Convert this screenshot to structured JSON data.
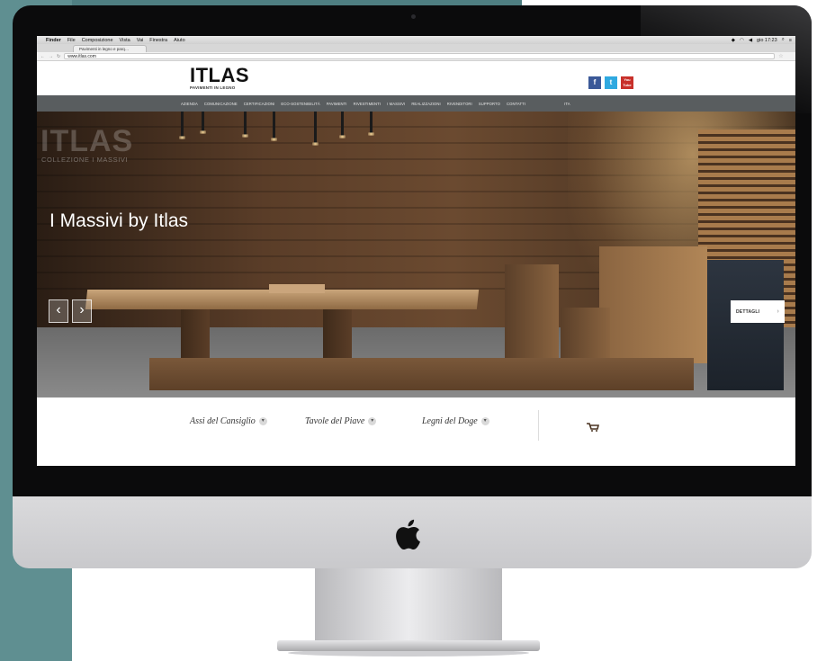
{
  "mac_menubar": {
    "apple_symbol": "",
    "items": [
      "Finder",
      "File",
      "Composizione",
      "Vista",
      "Vai",
      "Finestra",
      "Aiuto"
    ],
    "clock": "gio 17:23"
  },
  "browser": {
    "tab_title": "Pavimenti in legno e parq…",
    "url": "www.itlas.com"
  },
  "site": {
    "logo": "ITLAS",
    "tagline": "PAVIMENTI IN LEGNO",
    "social": [
      "f",
      "t",
      "You Tube"
    ],
    "nav": [
      "AZIENDA",
      "COMUNICAZIONE",
      "CERTIFICAZIONI",
      "ECO-SOSTENIBILITÀ",
      "PAVIMENTI",
      "RIVESTIMENTI",
      "I MASSIVI",
      "REALIZZAZIONI",
      "RIVENDITORI",
      "SUPPORTO",
      "CONTATTI"
    ],
    "language": "ITA"
  },
  "hero": {
    "bg_title": "ITLAS",
    "bg_subtitle": "COLLEZIONE I MASSIVI",
    "heading": "I Massivi by Itlas",
    "prev": "‹",
    "next": "›",
    "details_button": "DETTAGLI",
    "details_chevron": "›"
  },
  "collections": [
    {
      "name": "Assi del Cansiglio"
    },
    {
      "name": "Tavole del Piave"
    },
    {
      "name": "Legni del Doge"
    }
  ],
  "colors": {
    "teal_backdrop": "#4f7f82",
    "nav_bar": "#595d5f",
    "facebook": "#3b5998",
    "twitter": "#2fa9e0",
    "youtube": "#c8302a"
  }
}
